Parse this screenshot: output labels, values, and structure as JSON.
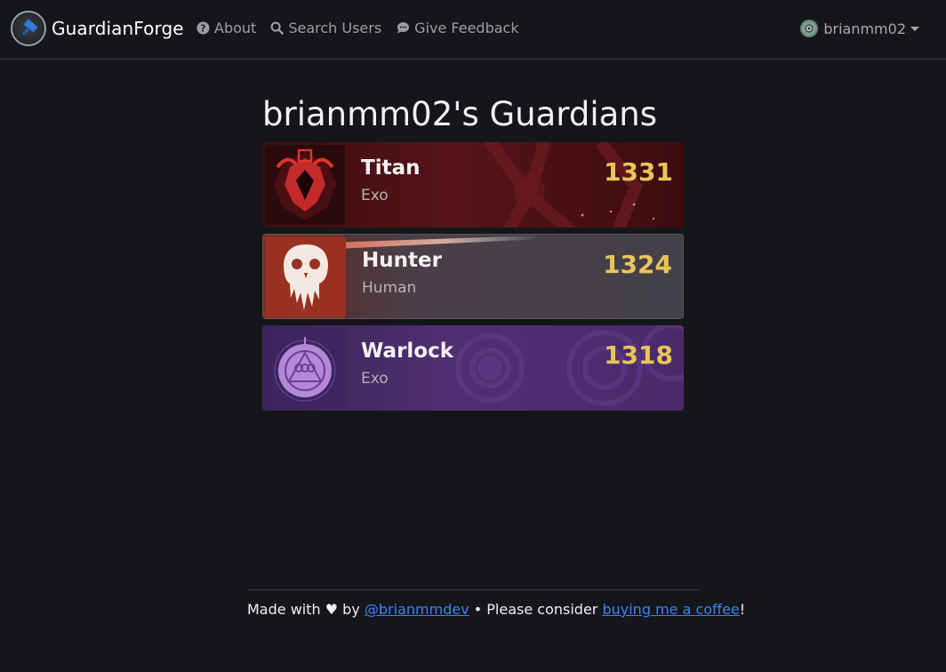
{
  "nav": {
    "brand": "GuardianForge",
    "links": [
      "About",
      "Search Users",
      "Give Feedback"
    ],
    "user": "brianmm02"
  },
  "page": {
    "title": "brianmm02's Guardians"
  },
  "guardians": [
    {
      "class_name": "Titan",
      "race": "Exo",
      "power": "1331",
      "theme": "titan",
      "emblem_icon": "titan-emblem-icon"
    },
    {
      "class_name": "Hunter",
      "race": "Human",
      "power": "1324",
      "theme": "hunter",
      "emblem_icon": "hunter-emblem-icon"
    },
    {
      "class_name": "Warlock",
      "race": "Exo",
      "power": "1318",
      "theme": "warlock",
      "emblem_icon": "warlock-emblem-icon"
    }
  ],
  "footer": {
    "prefix": "Made with",
    "heart": "♥",
    "by": "by",
    "author": "@brianmmdev",
    "mid": "• Please consider",
    "coffee_link": "buying me a coffee",
    "suffix": "!"
  },
  "colors": {
    "background": "#15161a",
    "power": "#e8c55a",
    "link": "#3b82f6"
  }
}
